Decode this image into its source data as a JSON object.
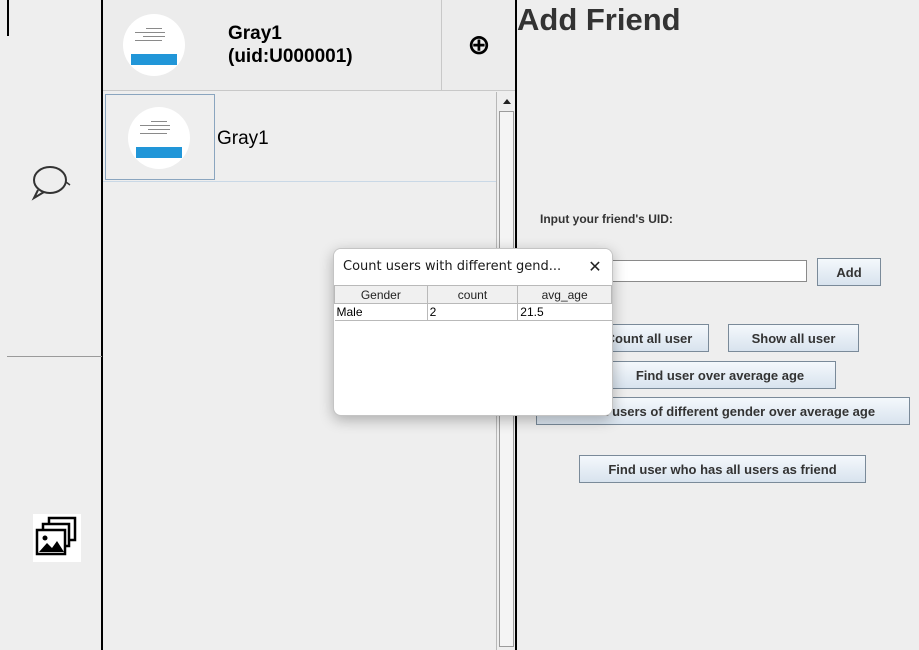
{
  "icons": {
    "chat": "speech-bubble-icon",
    "gallery": "image-gallery-icon",
    "add": "circle-plus-icon",
    "close": "close-icon"
  },
  "profile": {
    "name_line1": "Gray1",
    "name_line2": "(uid:U000001)",
    "add_button_glyph": "⊕"
  },
  "contacts": [
    {
      "name": "Gray1"
    }
  ],
  "add_friend": {
    "title": "Add Friend",
    "uid_label": "Input your friend's UID:",
    "uid_input_value": "",
    "add_button": "Add",
    "buttons": {
      "count_all": "Count all user",
      "show_all": "Show all user",
      "find_over_avg": "Find user over average age",
      "gender_over_avg": "Count users of different gender over average age",
      "all_friends": "Find user who has all users as friend"
    }
  },
  "dialog": {
    "title": "Count users with different gend...",
    "close_glyph": "✕",
    "columns": [
      "Gender",
      "count",
      "avg_age"
    ],
    "rows": [
      [
        "Male",
        "2",
        "21.5"
      ]
    ]
  },
  "colors": {
    "panel_bg": "#eeeeee",
    "button_top": "#f4f8fc",
    "button_bottom": "#d8e3ee",
    "avatar_band": "#2196d8"
  }
}
